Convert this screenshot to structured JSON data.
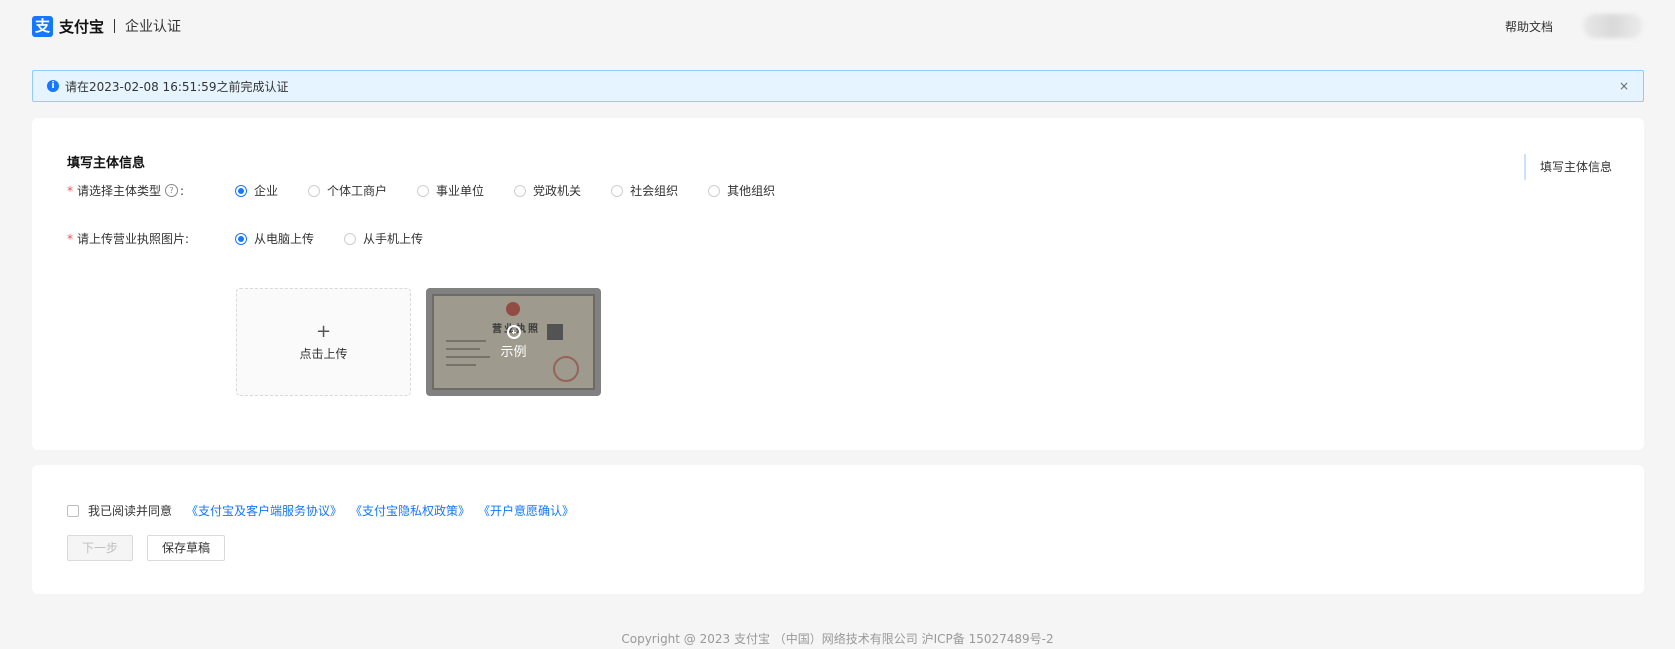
{
  "header": {
    "logo_glyph": "支",
    "brand_name": "支付宝",
    "brand_sub": "企业认证",
    "help_label": "帮助文档"
  },
  "alert": {
    "icon": "info-icon",
    "text": "请在2023-02-08 16:51:59之前完成认证",
    "close_glyph": "×"
  },
  "form": {
    "section_title": "填写主体信息",
    "anchor_label": "填写主体信息",
    "entity_type": {
      "label": "请选择主体类型",
      "required_mark": "*",
      "help_glyph": "?",
      "colon": ":",
      "options": [
        "企业",
        "个体工商户",
        "事业单位",
        "党政机关",
        "社会组织",
        "其他组织"
      ],
      "selected": "企业"
    },
    "license": {
      "label": "请上传营业执照图片:",
      "required_mark": "*",
      "options": [
        "从电脑上传",
        "从手机上传"
      ],
      "selected": "从电脑上传",
      "upload_plus": "+",
      "upload_text": "点击上传",
      "sample_text": "示例",
      "sample_license_title": "营业执照"
    }
  },
  "agreement": {
    "text": "我已阅读并同意",
    "links": [
      "《支付宝及客户端服务协议》",
      "《支付宝隐私权政策》",
      "《开户意愿确认》"
    ],
    "checked": false
  },
  "buttons": {
    "next_label": "下一步",
    "save_label": "保存草稿"
  },
  "footer": {
    "copyright": "Copyright @ 2023 支付宝 （中国）网络技术有限公司 沪ICP备 15027489号-2"
  },
  "colors": {
    "accent": "#1677ff",
    "required": "#ff4d4f",
    "alert_bg": "#e6f4ff"
  }
}
